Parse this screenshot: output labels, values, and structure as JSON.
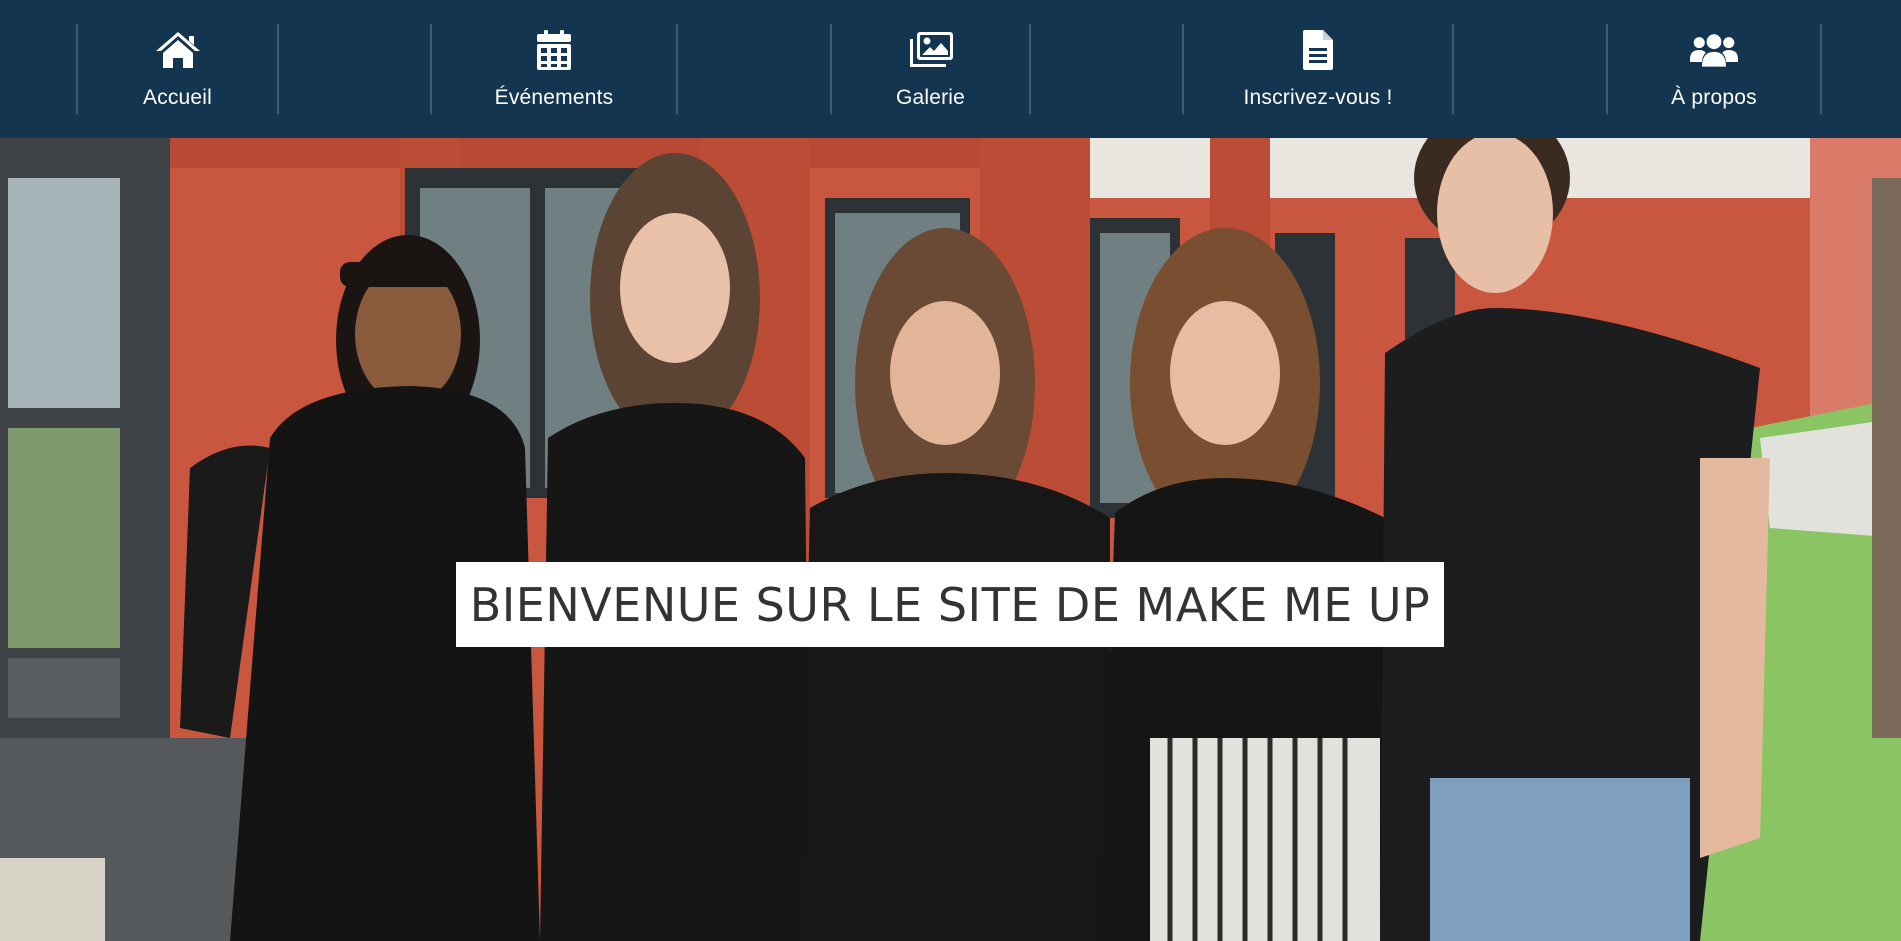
{
  "navbar": {
    "background": "#13354f",
    "items": [
      {
        "label": "Accueil",
        "icon": "home-icon"
      },
      {
        "label": "Événements",
        "icon": "calendar-icon"
      },
      {
        "label": "Galerie",
        "icon": "gallery-icon"
      },
      {
        "label": "Inscrivez-vous !",
        "icon": "document-icon"
      },
      {
        "label": "À propos",
        "icon": "users-icon"
      }
    ]
  },
  "hero": {
    "image": "group-photo",
    "banner_text": "BIENVENUE SUR LE SITE DE MAKE ME UP"
  }
}
